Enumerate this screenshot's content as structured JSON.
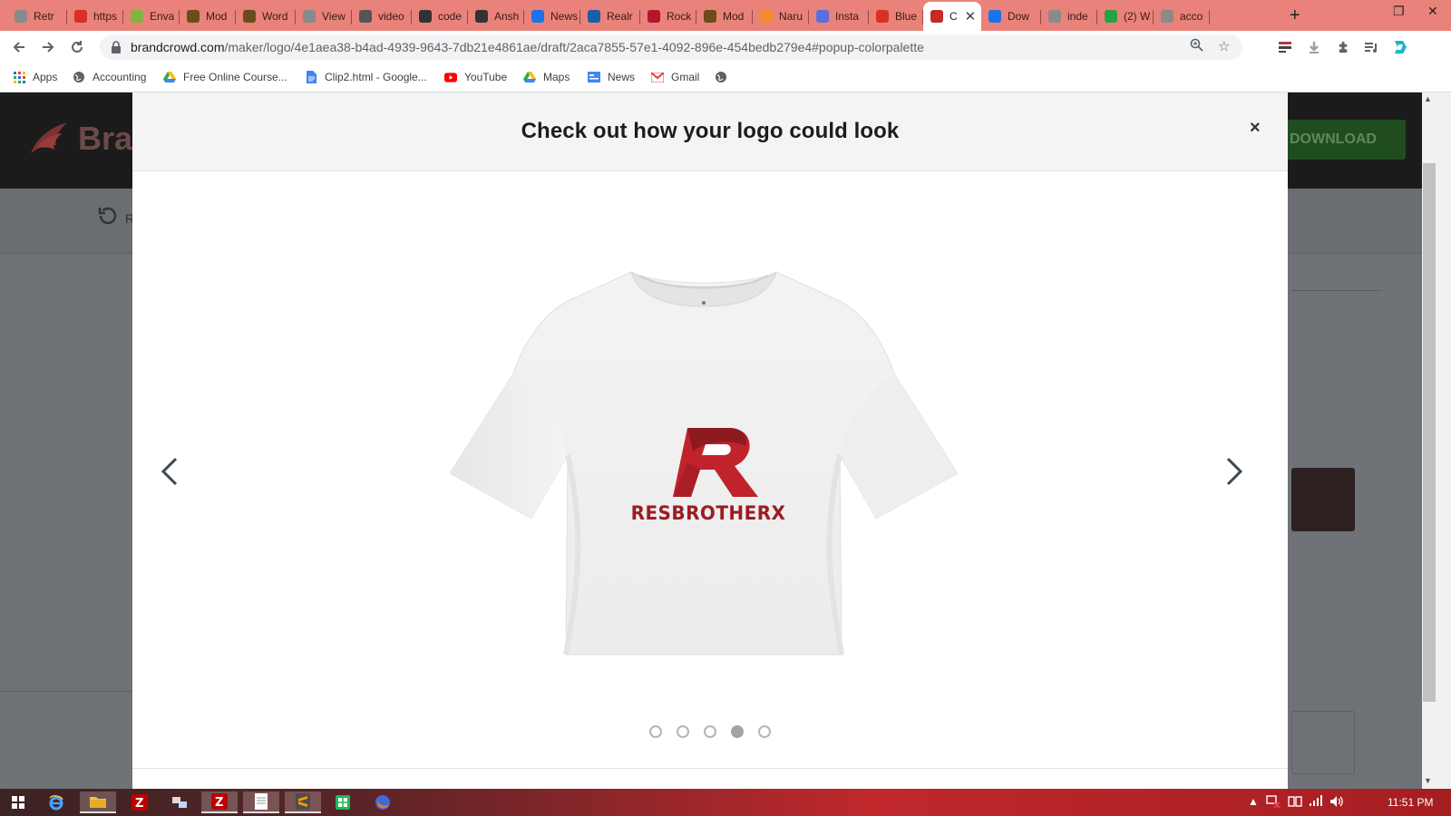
{
  "browser": {
    "tabs": [
      {
        "title": "Retr",
        "color": "#8a8a8a"
      },
      {
        "title": "https",
        "color": "#d93025"
      },
      {
        "title": "Enva",
        "color": "#81b441"
      },
      {
        "title": "Mod",
        "color": "#6b4c1a"
      },
      {
        "title": "Word",
        "color": "#6b4c1a"
      },
      {
        "title": "View",
        "color": "#8a8a8a"
      },
      {
        "title": "video",
        "color": "#555555"
      },
      {
        "title": "code",
        "color": "#333333"
      },
      {
        "title": "Ansh",
        "color": "#333333"
      },
      {
        "title": "News",
        "color": "#1a73e8"
      },
      {
        "title": "Realr",
        "color": "#1a5fa8"
      },
      {
        "title": "Rock",
        "color": "#b3152f"
      },
      {
        "title": "Mod",
        "color": "#6b4c1a"
      },
      {
        "title": "Naru",
        "color": "#f28b30"
      },
      {
        "title": "Insta",
        "color": "#5b6ee1"
      },
      {
        "title": "Blue",
        "color": "#d93025"
      },
      {
        "title": "C",
        "color": "#c42b25"
      },
      {
        "title": "Dow",
        "color": "#1a73e8"
      },
      {
        "title": "inde",
        "color": "#8a8a8a"
      },
      {
        "title": "(2) W",
        "color": "#25a244"
      },
      {
        "title": "acco",
        "color": "#8a8a8a"
      }
    ],
    "new_tab": "+",
    "url_host": "brandcrowd.com",
    "url_path": "/maker/logo/4e1aea38-b4ad-4939-9643-7db21e4861ae/draft/2aca7855-57e1-4092-896e-454bedb279e4#popup-colorpalette",
    "bookmarks": [
      {
        "label": "Apps"
      },
      {
        "label": "Accounting"
      },
      {
        "label": "Free Online Course..."
      },
      {
        "label": "Clip2.html - Google..."
      },
      {
        "label": "YouTube"
      },
      {
        "label": "Maps"
      },
      {
        "label": "News"
      },
      {
        "label": "Gmail"
      }
    ]
  },
  "page": {
    "brand": "Bra",
    "download_label": "DOWNLOAD",
    "undo_label": "R"
  },
  "modal": {
    "title": "Check out how your logo could look",
    "close": "×",
    "logo_text": "RESBROTHERX",
    "slides": 5,
    "active_slide": 4
  },
  "colors": {
    "logo_red": "#c0232b",
    "logo_dark": "#8d1a1f",
    "tab_bar": "#e8827a",
    "download_green": "#1f4d1f"
  },
  "taskbar": {
    "clock": "11:51 PM"
  }
}
